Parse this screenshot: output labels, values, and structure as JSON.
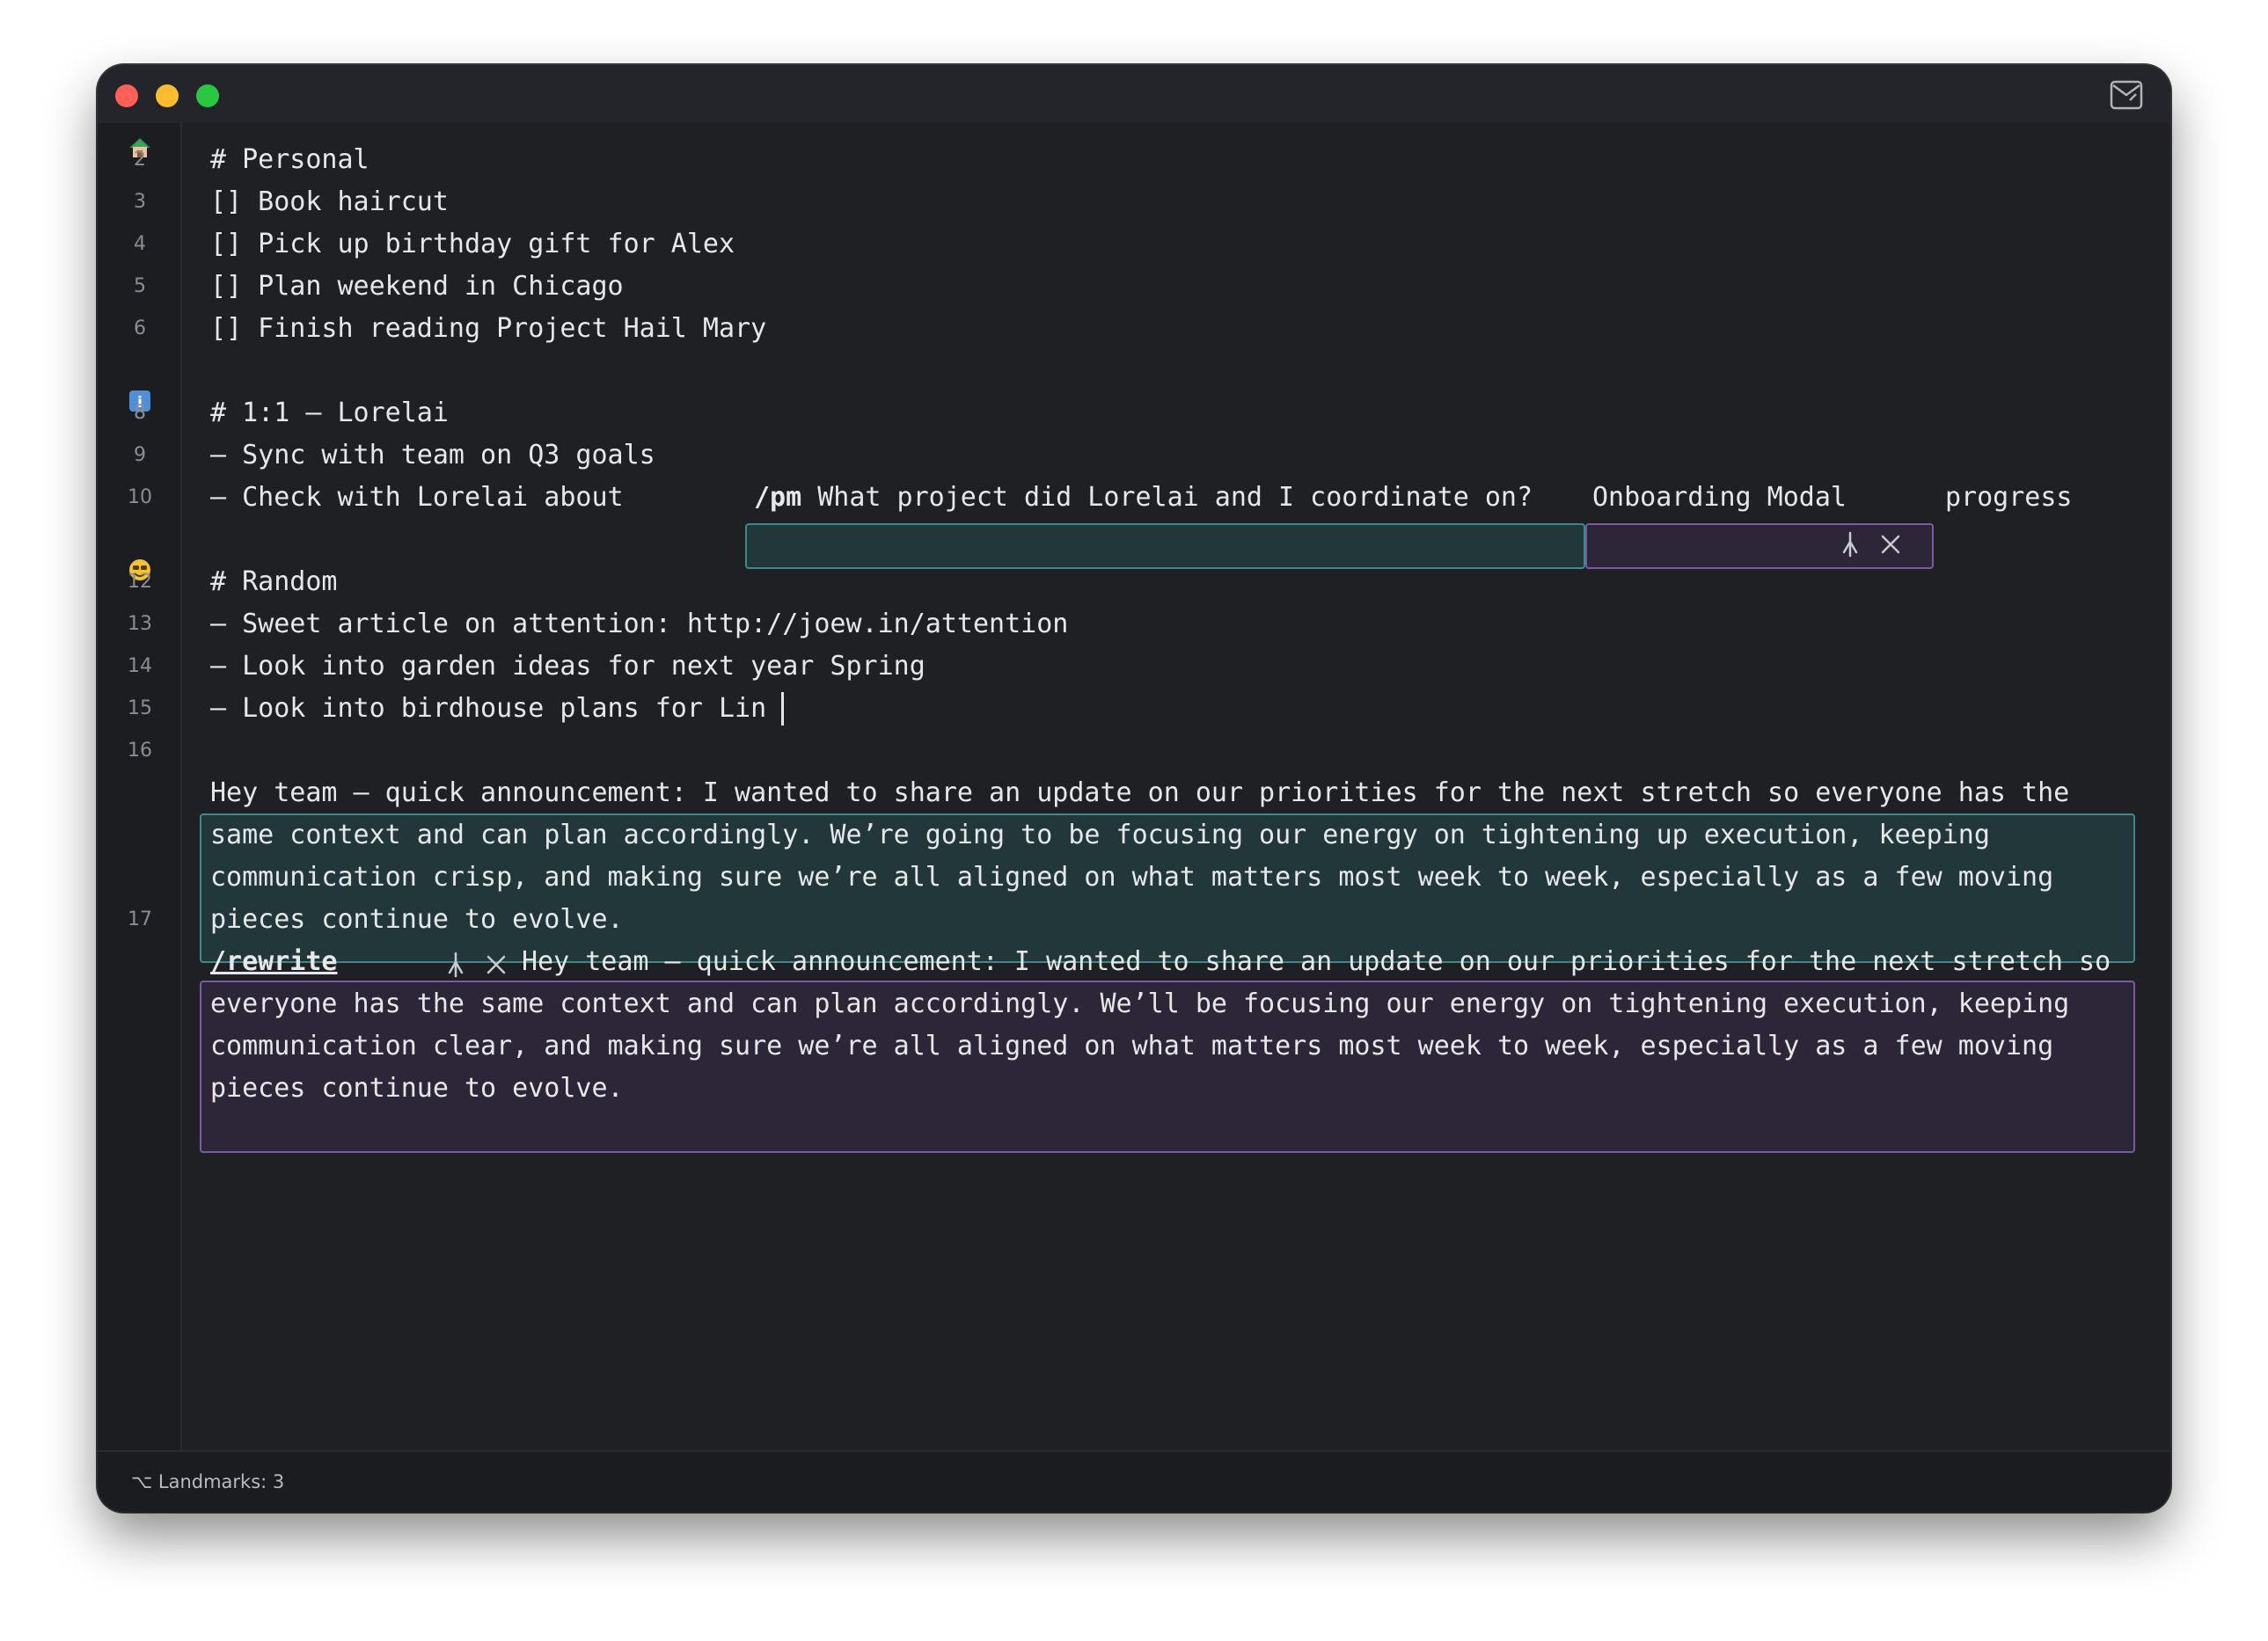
{
  "window": {
    "controls": [
      "close",
      "minimize",
      "maximize"
    ],
    "top_right_icon": "sidebar-toggle-icon"
  },
  "gutter": {
    "line_numbers": [
      "2",
      "3",
      "4",
      "5",
      "6",
      "8",
      "9",
      "10",
      "12",
      "13",
      "14",
      "15",
      "16",
      "17"
    ],
    "landmark_icons": {
      "line1": "house-icon",
      "line7": "info-icon",
      "line11": "smile-icon"
    }
  },
  "editor": {
    "lines": {
      "l1": "# Personal",
      "l2": "[] Book haircut",
      "l3": "[] Pick up birthday gift for Alex",
      "l4": "[] Plan weekend in Chicago",
      "l5": "[] Finish reading Project Hail Mary",
      "l7": "# 1:1 – Lorelai",
      "l8": "– Sync with team on Q3 goals",
      "l9_prefix": "– Check with Lorelai about ",
      "l9_command": "/pm",
      "l9_query": " What project did Lorelai and I coordinate on?",
      "l9_result": "Onboarding Modal",
      "l9_suffix": "progress",
      "l11": "# Random",
      "l12": "– Sweet article on attention: http://joew.in/attention",
      "l13": "– Look into garden ideas for next year Spring",
      "l14": "– Look into birdhouse plans for Lin"
    },
    "block16": [
      "Hey team — quick announcement: I wanted to share an update on our priorities for the next stretch so everyone has the",
      "same context and can plan accordingly. We’re going to be focusing our energy on tightening up execution, keeping",
      "communication crisp, and making sure we’re all aligned on what matters most week to week, especially as a few moving",
      "pieces continue to evolve."
    ],
    "block17": {
      "command": "/rewrite",
      "lines": [
        "Hey team — quick announcement: I wanted to share an update on our priorities for the next stretch so",
        "everyone has the same context and can plan accordingly. We’ll be focusing our energy on tightening execution, keeping",
        "communication clear, and making sure we’re all aligned on what matters most week to week, especially as a few moving",
        "pieces continue to evolve."
      ]
    }
  },
  "statusbar": {
    "glyph": "⌥",
    "text": "Landmarks: 3"
  },
  "colors": {
    "teal_border": "#3d8a8a",
    "purple_border": "#7a5aa6",
    "background": "#1e2024"
  }
}
